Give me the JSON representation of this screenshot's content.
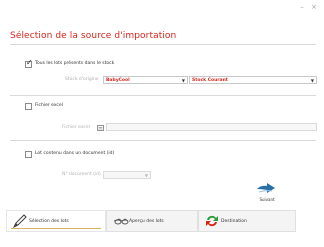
{
  "window": {
    "minimize_glyph": "–",
    "close_glyph": "×"
  },
  "title": "Sélection de la source d'importation",
  "options": {
    "all_lots": {
      "label": "Tous les lots présents dans le stock",
      "checked": true,
      "stock_origin_label": "Stock d'origine",
      "stock_origin_value": "BabyCool",
      "stock_target_value": "Stock Courant"
    },
    "excel": {
      "label": "Fichier excel",
      "checked": false,
      "file_label": "Fichier excel"
    },
    "document": {
      "label": "Lot contenu dans un document (id)",
      "checked": false,
      "doc_number_label": "N° document (id)"
    }
  },
  "next_button": {
    "label": "Suivant"
  },
  "tabs": [
    {
      "label": "Sélection des lots",
      "icon": "pen-icon",
      "active": true
    },
    {
      "label": "Aperçu des lots",
      "icon": "glasses-icon",
      "active": false
    },
    {
      "label": "Destination",
      "icon": "exchange-arrows-icon",
      "active": false
    }
  ],
  "colors": {
    "accent_red": "#d9241b",
    "arrow_blue": "#2a6ea6"
  }
}
